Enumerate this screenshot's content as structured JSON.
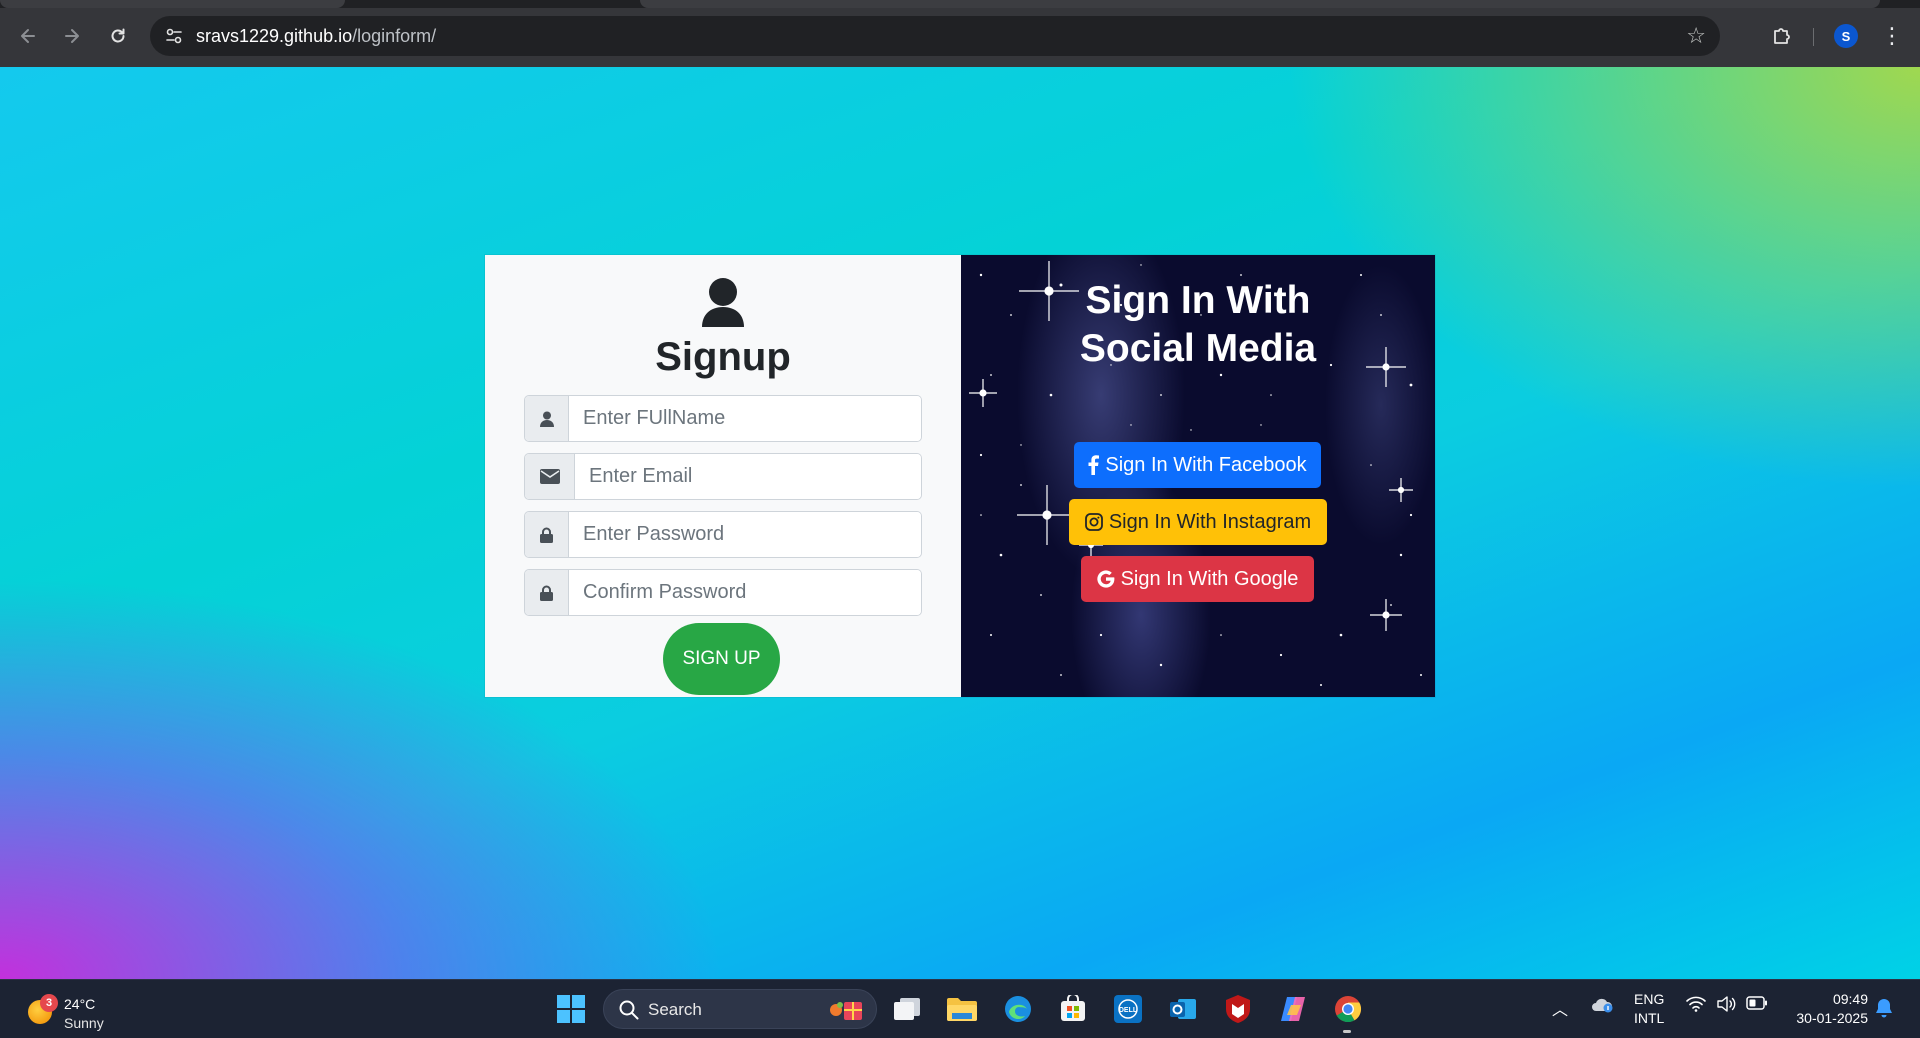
{
  "browser": {
    "url_host": "sravs1229.github.io",
    "url_path": "/loginform/",
    "profile_initial": "S"
  },
  "signup": {
    "title": "Signup",
    "fields": {
      "fullname_placeholder": "Enter FUllName",
      "email_placeholder": "Enter Email",
      "password_placeholder": "Enter Password",
      "confirm_placeholder": "Confirm Password"
    },
    "submit_label": "SIGN UP"
  },
  "social": {
    "title_line1": "Sign In With",
    "title_line2": "Social Media",
    "facebook_label": "Sign In With Facebook",
    "instagram_label": "Sign In With Instagram",
    "google_label": "Sign In With Google"
  },
  "taskbar": {
    "weather_badge": "3",
    "weather_temp": "24°C",
    "weather_cond": "Sunny",
    "search_label": "Search",
    "lang_line1": "ENG",
    "lang_line2": "INTL",
    "time": "09:49",
    "date": "30-01-2025"
  },
  "colors": {
    "signup_button": "#28a745",
    "facebook": "#0d6efd",
    "instagram": "#ffc107",
    "google": "#dc3545"
  }
}
